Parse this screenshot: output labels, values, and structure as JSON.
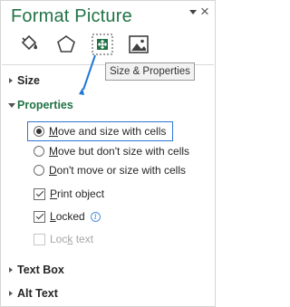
{
  "pane": {
    "title": "Format Picture",
    "close_glyph": "×"
  },
  "tabs": [
    {
      "icon": "paint-bucket-icon",
      "label": ""
    },
    {
      "icon": "pentagon-icon",
      "label": ""
    },
    {
      "icon": "size-properties-icon",
      "label": ""
    },
    {
      "icon": "picture-icon",
      "label": ""
    }
  ],
  "tooltip": {
    "text": "Size & Properties"
  },
  "sections": {
    "size": "Size",
    "properties": "Properties",
    "textbox": "Text Box",
    "alttext": "Alt Text"
  },
  "options": {
    "move_size": {
      "pre": "",
      "ul": "M",
      "post": "ove and size with cells",
      "selected": true
    },
    "move_no_size": {
      "pre": "",
      "ul": "M",
      "post": "ove but don't size with cells",
      "selected": false
    },
    "no_move": {
      "pre": "",
      "ul": "D",
      "post": "on't move or size with cells",
      "selected": false
    },
    "print": {
      "pre": "",
      "ul": "P",
      "post": "rint object",
      "checked": true
    },
    "locked": {
      "pre": "",
      "ul": "L",
      "post": "ocked",
      "checked": true
    },
    "lock_text": {
      "pre": "Loc",
      "ul": "k",
      "post": " text",
      "checked": false,
      "disabled": true
    }
  },
  "colors": {
    "accent_green": "#217346",
    "highlight_blue": "#2e75d6",
    "arrow_blue": "#1f78d8"
  }
}
